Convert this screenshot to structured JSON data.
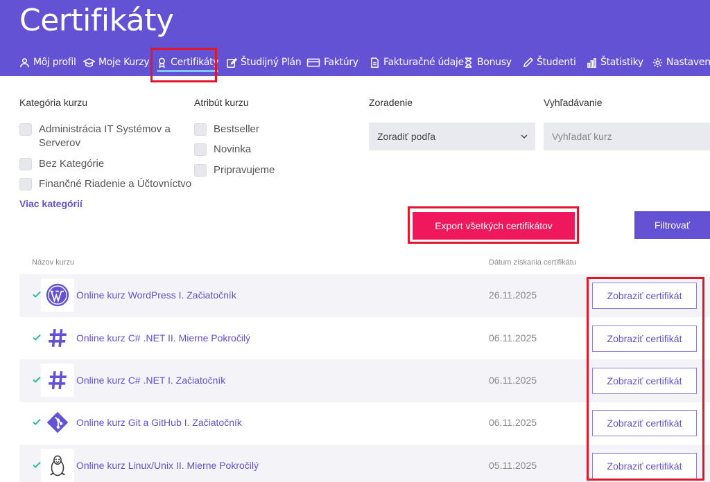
{
  "header": {
    "title": "Certifikáty",
    "nav": [
      {
        "label": "Môj profil",
        "icon": "user-icon"
      },
      {
        "label": "Moje Kurzy",
        "icon": "graduation-cap-icon"
      },
      {
        "label": "Certifikáty",
        "icon": "award-icon",
        "active": true
      },
      {
        "label": "Študijný Plán",
        "icon": "edit-icon"
      },
      {
        "label": "Faktúry",
        "icon": "credit-card-icon"
      },
      {
        "label": "Fakturačné údaje",
        "icon": "document-icon"
      },
      {
        "label": "Bonusy",
        "icon": "hourglass-icon"
      },
      {
        "label": "Študenti",
        "icon": "pencil-icon"
      },
      {
        "label": "Štatistiky",
        "icon": "bar-chart-icon"
      },
      {
        "label": "Nastavenia",
        "icon": "gear-icon"
      }
    ]
  },
  "filters": {
    "category": {
      "label": "Kategória kurzu",
      "options": [
        "Administrácia IT Systémov a Serverov",
        "Bez Kategórie",
        "Finančné Riadenie a Účtovníctvo"
      ],
      "more": "Viac kategórií"
    },
    "attribute": {
      "label": "Atribút kurzu",
      "options": [
        "Bestseller",
        "Novinka",
        "Pripravujeme"
      ]
    },
    "sort": {
      "label": "Zoradenie",
      "value": "Zoradiť podľa"
    },
    "search": {
      "label": "Vyhľadávanie",
      "placeholder": "Vyhľadať kurz",
      "value": ""
    }
  },
  "actions": {
    "export": "Export všetkých certifikátov",
    "filter": "Filtrovať"
  },
  "table": {
    "headers": {
      "name": "Názov kurzu",
      "date": "Dátum získania certifikátu"
    },
    "rows": [
      {
        "name": "Online kurz WordPress I. Začiatočník",
        "date": "26.11.2025",
        "button": "Zobraziť certifikát",
        "logo": "wordpress-icon"
      },
      {
        "name": "Online kurz C# .NET II. Mierne Pokročilý",
        "date": "06.11.2025",
        "button": "Zobraziť certifikát",
        "logo": "hash-icon"
      },
      {
        "name": "Online kurz C# .NET I. Začiatočník",
        "date": "06.11.2025",
        "button": "Zobraziť certifikát",
        "logo": "hash-icon"
      },
      {
        "name": "Online kurz Git a GitHub I. Začiatočník",
        "date": "06.11.2025",
        "button": "Zobraziť certifikát",
        "logo": "git-icon"
      },
      {
        "name": "Online kurz Linux/Unix II. Mierne Pokročilý",
        "date": "05.11.2025",
        "button": "Zobraziť certifikát",
        "logo": "linux-icon"
      }
    ]
  },
  "colors": {
    "brand": "#6352d3",
    "export_button": "#f0185c",
    "highlight": "#e0162b",
    "check": "#2bbf9a",
    "active_underline": "#7ec8ff"
  }
}
